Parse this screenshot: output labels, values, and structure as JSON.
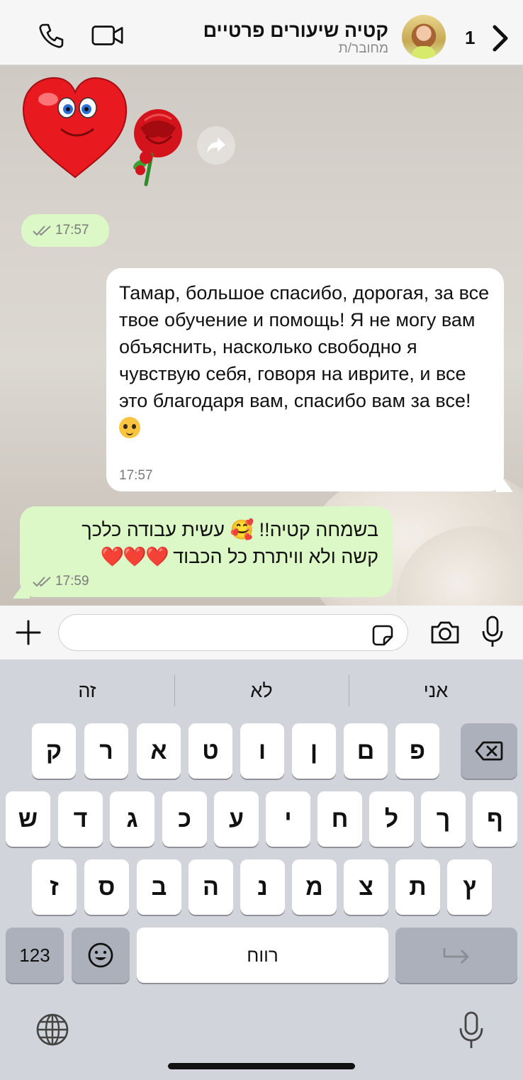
{
  "header": {
    "contact_name": "קטיה שיעורים פרטיים",
    "status": "מחובר/ת",
    "unread_count": "1"
  },
  "messages": {
    "sticker_time": "17:57",
    "ru_text": "Тамар, большое спасибо, дорогая, за все твое обучение и помощь! Я не могу вам объяснить, насколько свободно я чувствую себя, говоря на иврите, и все это благодаря вам, спасибо вам за все!",
    "ru_time": "17:57",
    "he_line1": "בשמחה קטיה!! 🥰 עשית עבודה כלכך",
    "he_line2": "קשה ולא וויתרת כל הכבוד",
    "he_hearts": "❤️❤️❤️",
    "he_time": "17:59"
  },
  "keyboard": {
    "suggestions": [
      "זה",
      "לא",
      "אני"
    ],
    "row1": [
      "ק",
      "ר",
      "א",
      "ט",
      "ו",
      "ן",
      "ם",
      "פ"
    ],
    "row2": [
      "ש",
      "ד",
      "ג",
      "כ",
      "ע",
      "י",
      "ח",
      "ל",
      "ך",
      "ף"
    ],
    "row3": [
      "ז",
      "ס",
      "ב",
      "ה",
      "נ",
      "מ",
      "צ",
      "ת",
      "ץ"
    ],
    "numbers_label": "123",
    "space_label": "רווח"
  },
  "colors": {
    "outgoing_bubble": "#dcf8c6",
    "incoming_bubble": "#ffffff",
    "heart_red": "#e0182b"
  },
  "icons": [
    "phone-icon",
    "video-icon",
    "chevron-back-icon",
    "forward-icon",
    "read-ticks-icon",
    "plus-icon",
    "sticker-icon",
    "camera-icon",
    "mic-icon",
    "backspace-icon",
    "emoji-icon",
    "return-icon",
    "globe-icon"
  ]
}
